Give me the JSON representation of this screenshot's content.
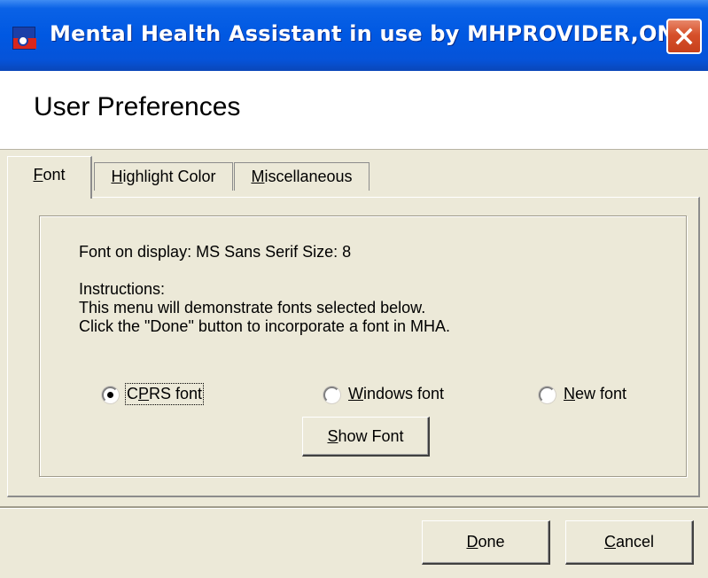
{
  "window": {
    "title": "Mental Health Assistant in use by MHPROVIDER,ONE"
  },
  "icons": {
    "app": "app-icon",
    "close": "close-icon"
  },
  "header": {
    "title": "User Preferences"
  },
  "tabs": [
    {
      "label_pre": "",
      "label_u": "F",
      "label_post": "ont",
      "active": true
    },
    {
      "label_pre": "",
      "label_u": "H",
      "label_post": "ighlight Color",
      "active": false
    },
    {
      "label_pre": "",
      "label_u": "M",
      "label_post": "iscellaneous",
      "active": false
    }
  ],
  "font_tab": {
    "font_info": "Font on display: MS Sans Serif   Size: 8",
    "instructions_title": "Instructions:",
    "instructions_line1": "This menu will demonstrate fonts selected below.",
    "instructions_line2": "Click the \"Done\" button to incorporate a font in MHA.",
    "radios": [
      {
        "pre": "C",
        "u": "P",
        "post": "RS font",
        "selected": true
      },
      {
        "pre": "",
        "u": "W",
        "post": "indows font",
        "selected": false
      },
      {
        "pre": "",
        "u": "N",
        "post": "ew font",
        "selected": false
      }
    ],
    "show_font_button": {
      "pre": "",
      "u": "S",
      "post": "how Font"
    }
  },
  "footer": {
    "done_button": {
      "pre": "",
      "u": "D",
      "post": "one"
    },
    "cancel_button": {
      "pre": "",
      "u": "C",
      "post": "ancel"
    }
  },
  "colors": {
    "titlebar": "#0058e2",
    "face": "#ece9d8",
    "close": "#d6502a"
  }
}
